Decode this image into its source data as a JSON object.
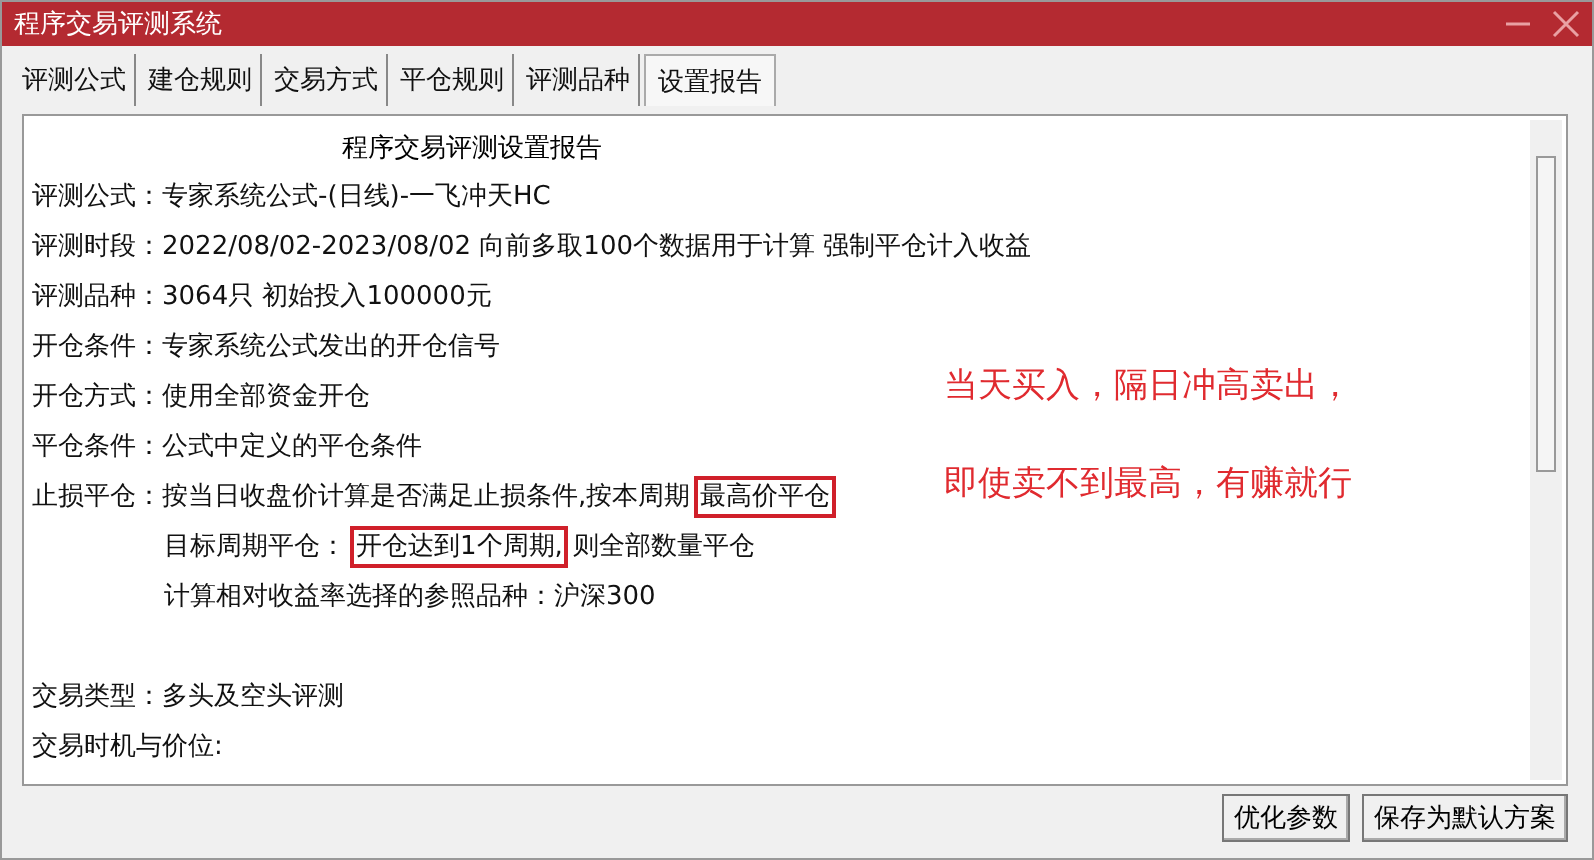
{
  "window": {
    "title": "程序交易评测系统"
  },
  "tabs": [
    {
      "label": "评测公式",
      "selected": false
    },
    {
      "label": "建仓规则",
      "selected": false
    },
    {
      "label": "交易方式",
      "selected": false
    },
    {
      "label": "平仓规则",
      "selected": false
    },
    {
      "label": "评测品种",
      "selected": false
    },
    {
      "label": "设置报告",
      "selected": true
    }
  ],
  "report": {
    "title": "程序交易评测设置报告",
    "lines": [
      {
        "kind": "field",
        "parts": [
          {
            "text": "评测公式：",
            "boxed": false
          },
          {
            "text": "专家系统公式-(日线)-一飞冲天HC",
            "boxed": false
          }
        ]
      },
      {
        "kind": "field",
        "parts": [
          {
            "text": "评测时段：",
            "boxed": false
          },
          {
            "text": "2022/08/02-2023/08/02 向前多取100个数据用于计算 强制平仓计入收益",
            "boxed": false
          }
        ]
      },
      {
        "kind": "field",
        "parts": [
          {
            "text": "评测品种：",
            "boxed": false
          },
          {
            "text": "3064只 初始投入100000元",
            "boxed": false
          }
        ]
      },
      {
        "kind": "field",
        "parts": [
          {
            "text": "开仓条件：",
            "boxed": false
          },
          {
            "text": "专家系统公式发出的开仓信号",
            "boxed": false
          }
        ]
      },
      {
        "kind": "field",
        "parts": [
          {
            "text": "开仓方式：",
            "boxed": false
          },
          {
            "text": "使用全部资金开仓",
            "boxed": false
          }
        ]
      },
      {
        "kind": "field",
        "parts": [
          {
            "text": "平仓条件：",
            "boxed": false
          },
          {
            "text": "公式中定义的平仓条件",
            "boxed": false
          }
        ]
      },
      {
        "kind": "field",
        "parts": [
          {
            "text": "止损平仓：",
            "boxed": false
          },
          {
            "text": "按当日收盘价计算是否满足止损条件,按本周期",
            "boxed": false
          },
          {
            "text": "最高价平仓",
            "boxed": true
          }
        ]
      },
      {
        "kind": "sub",
        "parts": [
          {
            "text": "目标周期平仓：",
            "boxed": false
          },
          {
            "text": "开仓达到1个周期,",
            "boxed": true
          },
          {
            "text": "则全部数量平仓",
            "boxed": false
          }
        ]
      },
      {
        "kind": "sub",
        "parts": [
          {
            "text": "计算相对收益率选择的参照品种：沪深300",
            "boxed": false
          }
        ]
      },
      {
        "kind": "blank"
      },
      {
        "kind": "field",
        "parts": [
          {
            "text": "交易类型：",
            "boxed": false
          },
          {
            "text": "多头及空头评测",
            "boxed": false
          }
        ]
      },
      {
        "kind": "field",
        "parts": [
          {
            "text": "交易时机与价位:",
            "boxed": false
          }
        ]
      }
    ],
    "annotations": [
      "当天买入，隔日冲高卖出，",
      "即使卖不到最高，有赚就行"
    ]
  },
  "buttons": [
    "优化参数",
    "保存为默认方案"
  ]
}
